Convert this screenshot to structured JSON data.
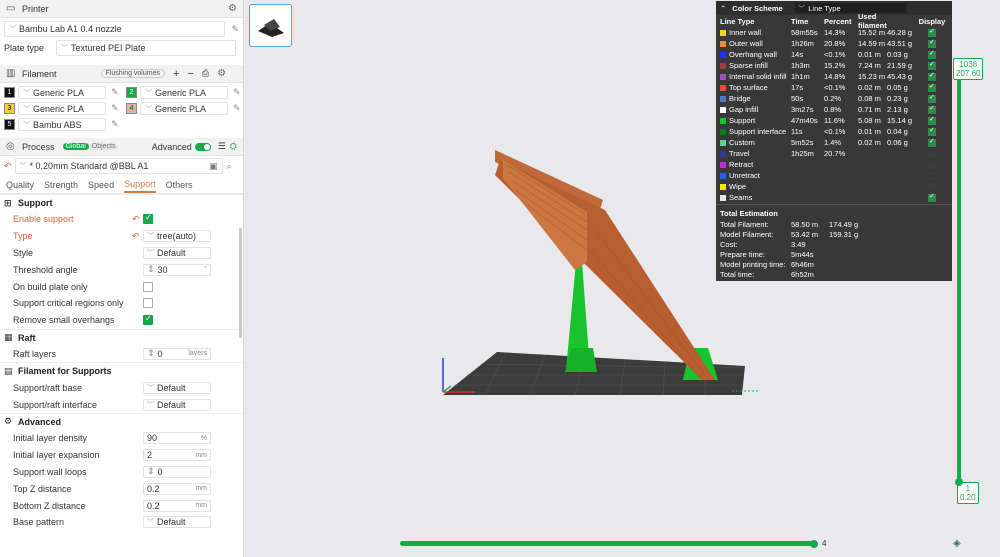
{
  "printer": {
    "section": "Printer",
    "name": "Bambu Lab A1 0.4 nozzle",
    "plate_type_label": "Plate type",
    "plate_type": "Textured PEI Plate"
  },
  "filament": {
    "section": "Filament",
    "flushing": "Flushing volumes",
    "slots": [
      {
        "num": "1",
        "name": "Generic PLA",
        "color": "#111111",
        "text": "#ffffff"
      },
      {
        "num": "2",
        "name": "Generic PLA",
        "color": "#18a94b",
        "text": "#ffffff"
      },
      {
        "num": "3",
        "name": "Generic PLA",
        "color": "#f5d321",
        "text": "#000000"
      },
      {
        "num": "4",
        "name": "Generic PLA",
        "color": "#d5b9a2",
        "text": "#333333"
      },
      {
        "num": "5",
        "name": "Bambu ABS",
        "color": "#111111",
        "text": "#ffffff"
      }
    ]
  },
  "process": {
    "section": "Process",
    "global": "Global",
    "objects": "Objects",
    "advanced": "Advanced",
    "preset": "* 0.20mm Standard @BBL A1",
    "tabs": [
      "Quality",
      "Strength",
      "Speed",
      "Support",
      "Others"
    ],
    "active_tab": "Support"
  },
  "support": {
    "group": "Support",
    "enable_label": "Enable support",
    "type_label": "Type",
    "type_value": "tree(auto)",
    "style_label": "Style",
    "style_value": "Default",
    "threshold_label": "Threshold angle",
    "threshold_value": "30",
    "threshold_unit": "°",
    "build_plate_label": "On build plate only",
    "critical_label": "Support critical regions only",
    "remove_small_label": "Remove small overhangs"
  },
  "raft": {
    "group": "Raft",
    "layers_label": "Raft layers",
    "layers_value": "0",
    "layers_unit": "layers"
  },
  "fil_supports": {
    "group": "Filament for Supports",
    "base_label": "Support/raft base",
    "base_value": "Default",
    "iface_label": "Support/raft interface",
    "iface_value": "Default"
  },
  "advanced": {
    "group": "Advanced",
    "rows": [
      {
        "label": "Initial layer density",
        "value": "90",
        "unit": "%",
        "kind": "inp"
      },
      {
        "label": "Initial layer expansion",
        "value": "2",
        "unit": "mm",
        "kind": "inp"
      },
      {
        "label": "Support wall loops",
        "value": "0",
        "unit": "",
        "kind": "spin"
      },
      {
        "label": "Top Z distance",
        "value": "0.2",
        "unit": "mm",
        "kind": "inp"
      },
      {
        "label": "Bottom Z distance",
        "value": "0.2",
        "unit": "mm",
        "kind": "inp"
      },
      {
        "label": "Base pattern",
        "value": "Default",
        "unit": "",
        "kind": "sel"
      }
    ]
  },
  "legend": {
    "title": "Color Scheme",
    "view_type": "Line Type",
    "headers": [
      "Line Type",
      "Time",
      "Percent",
      "Used filament",
      "",
      "Display"
    ],
    "rows": [
      {
        "name": "Inner wall",
        "color": "#f5d321",
        "time": "58m55s",
        "pct": "14.3%",
        "len": "15.52 m",
        "wt": "46.28 g",
        "on": true
      },
      {
        "name": "Outer wall",
        "color": "#f08c3b",
        "time": "1h26m",
        "pct": "20.8%",
        "len": "14.59 m",
        "wt": "43.51 g",
        "on": true
      },
      {
        "name": "Overhang wall",
        "color": "#1a36f0",
        "time": "14s",
        "pct": "<0.1%",
        "len": "0.01 m",
        "wt": "0.03 g",
        "on": true
      },
      {
        "name": "Sparse infill",
        "color": "#a83a44",
        "time": "1h3m",
        "pct": "15.2%",
        "len": "7.24 m",
        "wt": "21.59 g",
        "on": true
      },
      {
        "name": "Internal solid infill",
        "color": "#9b4fc0",
        "time": "1h1m",
        "pct": "14.8%",
        "len": "15.23 m",
        "wt": "45.43 g",
        "on": true
      },
      {
        "name": "Top surface",
        "color": "#e34d3e",
        "time": "17s",
        "pct": "<0.1%",
        "len": "0.02 m",
        "wt": "0.05 g",
        "on": true
      },
      {
        "name": "Bridge",
        "color": "#4d7ac0",
        "time": "50s",
        "pct": "0.2%",
        "len": "0.08 m",
        "wt": "0.23 g",
        "on": true
      },
      {
        "name": "Gap infill",
        "color": "#ffffff",
        "time": "3m27s",
        "pct": "0.8%",
        "len": "0.71 m",
        "wt": "2.13 g",
        "on": true
      },
      {
        "name": "Support",
        "color": "#19c32d",
        "time": "47m40s",
        "pct": "11.6%",
        "len": "5.08 m",
        "wt": "15.14 g",
        "on": true
      },
      {
        "name": "Support interface",
        "color": "#0f7a1c",
        "time": "11s",
        "pct": "<0.1%",
        "len": "0.01 m",
        "wt": "0.04 g",
        "on": true
      },
      {
        "name": "Custom",
        "color": "#5dd39e",
        "time": "5m52s",
        "pct": "1.4%",
        "len": "0.02 m",
        "wt": "0.06 g",
        "on": true
      },
      {
        "name": "Travel",
        "color": "#2e3a8c",
        "time": "1h25m",
        "pct": "20.7%",
        "len": "",
        "wt": "",
        "on": false
      },
      {
        "name": "Retract",
        "color": "#c12ad6",
        "time": "",
        "pct": "",
        "len": "",
        "wt": "",
        "on": false
      },
      {
        "name": "Unretract",
        "color": "#1e63e8",
        "time": "",
        "pct": "",
        "len": "",
        "wt": "",
        "on": false
      },
      {
        "name": "Wipe",
        "color": "#f5e21c",
        "time": "",
        "pct": "",
        "len": "",
        "wt": "",
        "on": false
      },
      {
        "name": "Seams",
        "color": "#e6e6e6",
        "time": "",
        "pct": "",
        "len": "",
        "wt": "",
        "on": true
      }
    ],
    "estimation_title": "Total Estimation",
    "estimation": [
      {
        "label": "Total Filament:",
        "a": "58.50 m",
        "b": "174.49 g"
      },
      {
        "label": "Model Filament:",
        "a": "53.42 m",
        "b": "159.31 g"
      },
      {
        "label": "Cost:",
        "a": "3.49",
        "b": ""
      },
      {
        "label": "Prepare time:",
        "a": "5m44s",
        "b": ""
      },
      {
        "label": "Model printing time:",
        "a": "6h46m",
        "b": ""
      },
      {
        "label": "Total time:",
        "a": "6h52m",
        "b": ""
      }
    ]
  },
  "layer_slider": {
    "top_layer": "1038",
    "top_height": "207.60",
    "bottom_layer": "1",
    "bottom_height": "0.20",
    "move_value": "4"
  }
}
